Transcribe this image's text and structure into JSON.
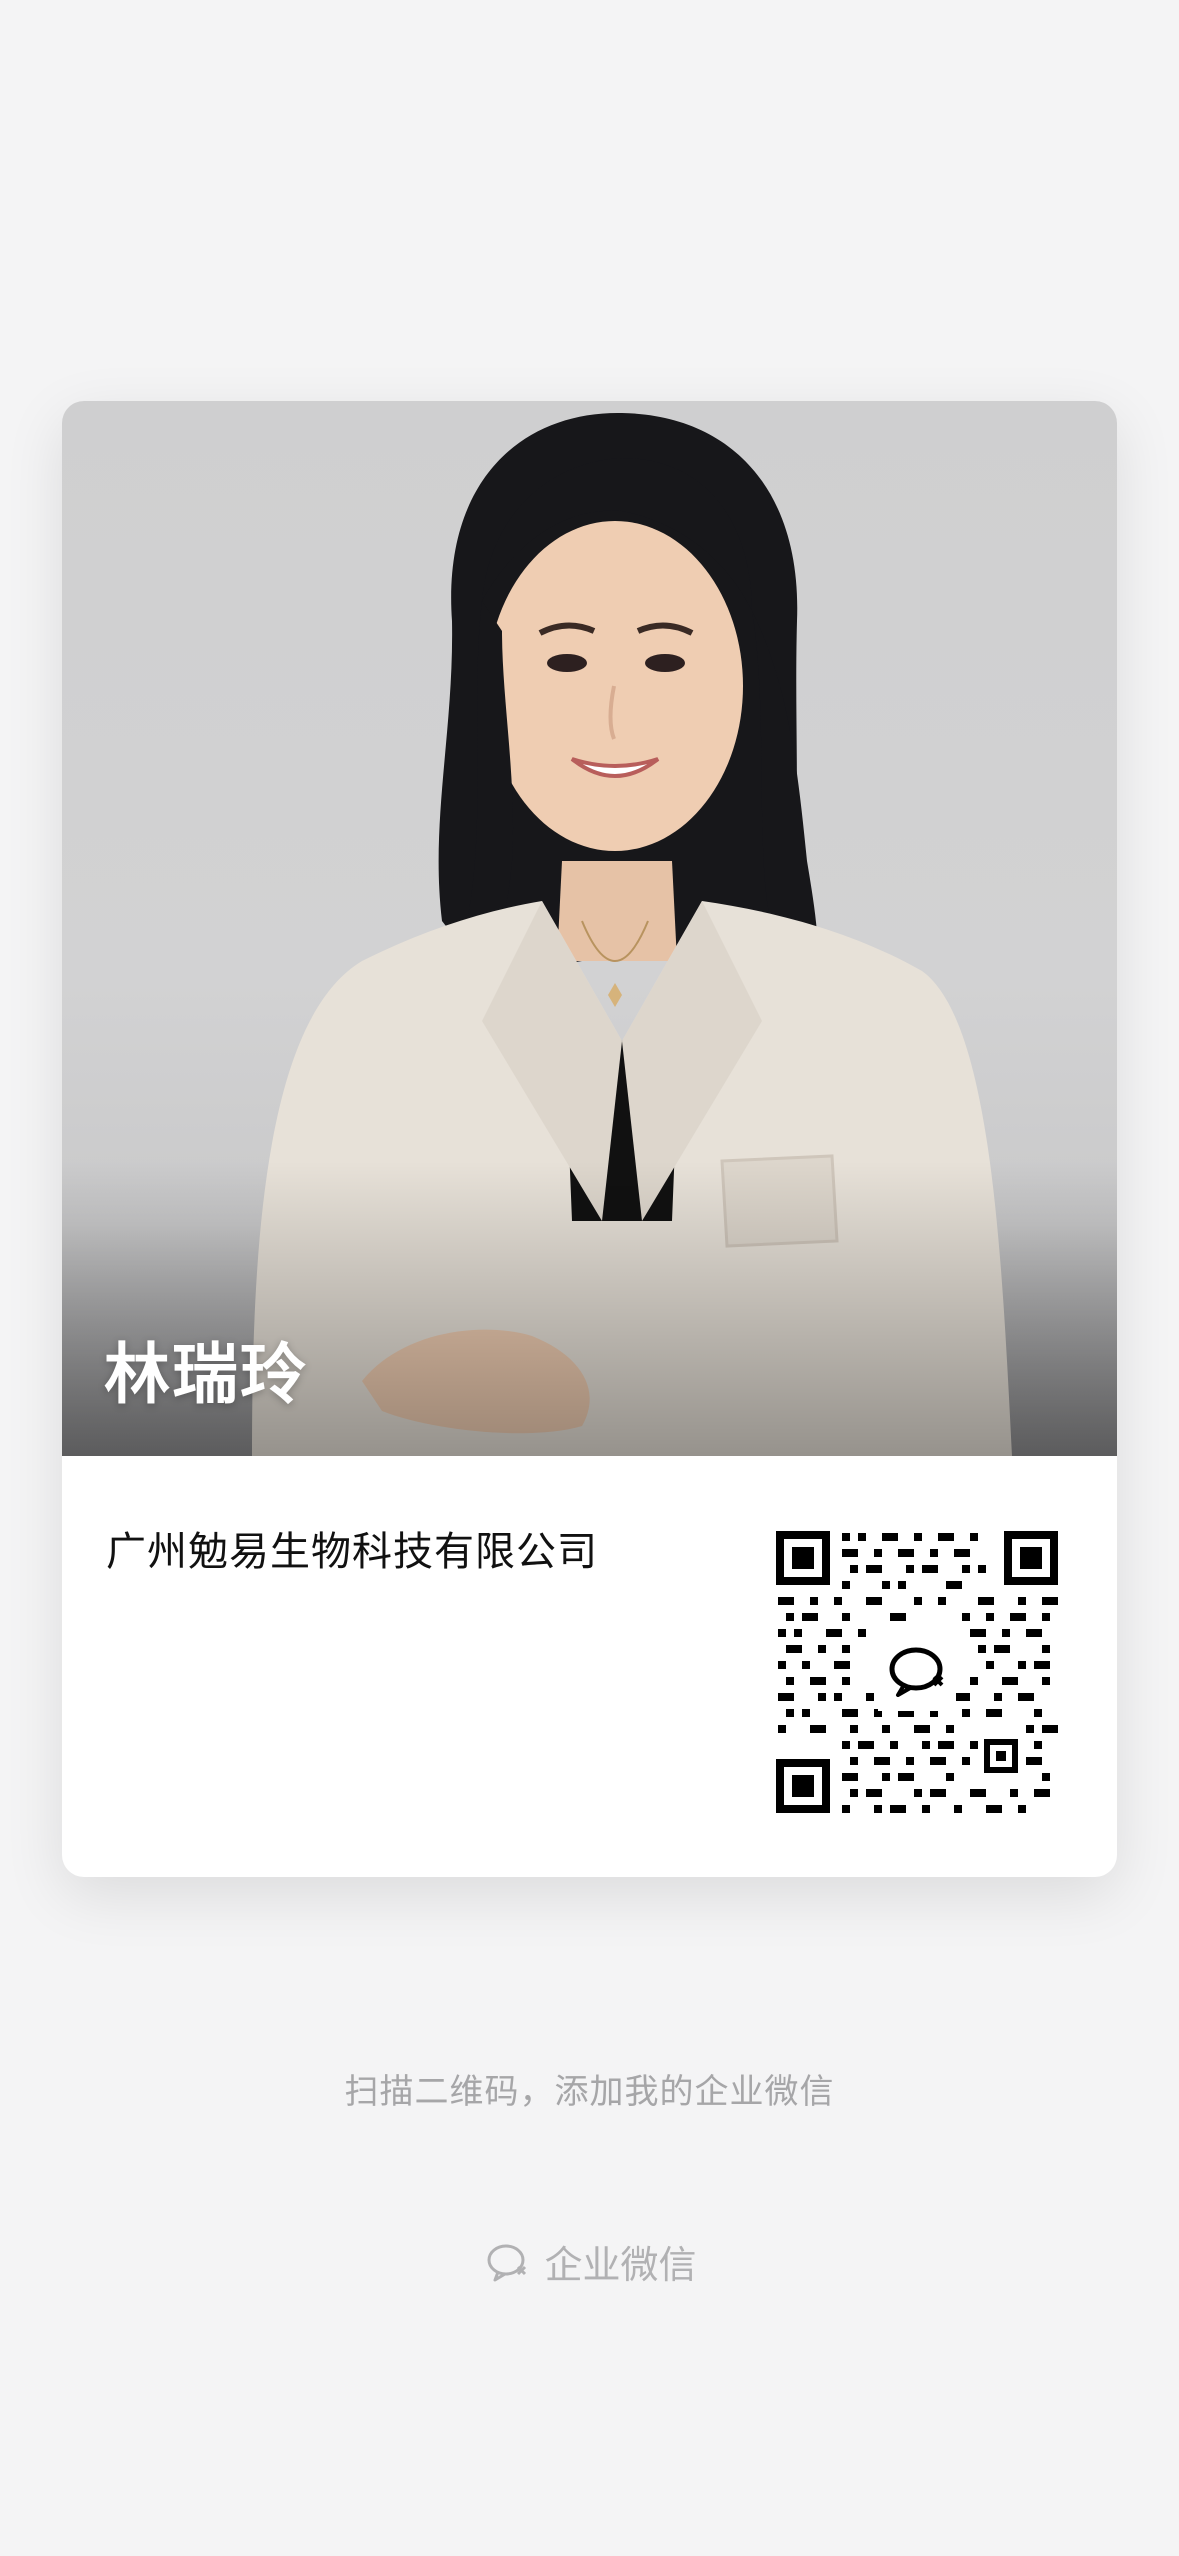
{
  "card": {
    "person_name": "林瑞玲",
    "company": "广州勉易生物科技有限公司"
  },
  "qr": {
    "icon": "wechat-work-icon"
  },
  "hint": "扫描二维码，添加我的企业微信",
  "footer": {
    "icon": "wechat-work-icon",
    "label": "企业微信"
  },
  "colors": {
    "background": "#f4f4f5",
    "card": "#ffffff",
    "hint_text": "#a6a6a8"
  }
}
